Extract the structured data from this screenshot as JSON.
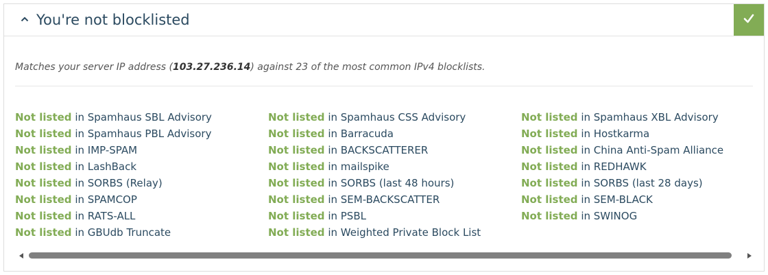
{
  "header": {
    "title": "You're not blocklisted",
    "chevron_icon": "chevron-up-icon",
    "status_icon": "checkmark-icon",
    "status_color": "#82ac55"
  },
  "description": {
    "prefix": "Matches your server IP address (",
    "ip": "103.27.236.14",
    "suffix": ") against 23 of the most common IPv4 blocklists."
  },
  "columns": [
    [
      {
        "status": "Not listed",
        "sep": " in ",
        "name": "Spamhaus SBL Advisory"
      },
      {
        "status": "Not listed",
        "sep": " in ",
        "name": "Spamhaus PBL Advisory"
      },
      {
        "status": "Not listed",
        "sep": " in ",
        "name": "IMP-SPAM"
      },
      {
        "status": "Not listed",
        "sep": " in ",
        "name": "LashBack"
      },
      {
        "status": "Not listed",
        "sep": " in ",
        "name": "SORBS (Relay)"
      },
      {
        "status": "Not listed",
        "sep": " in ",
        "name": "SPAMCOP"
      },
      {
        "status": "Not listed",
        "sep": " in ",
        "name": "RATS-ALL"
      },
      {
        "status": "Not listed",
        "sep": " in ",
        "name": "GBUdb Truncate"
      }
    ],
    [
      {
        "status": "Not listed",
        "sep": " in ",
        "name": "Spamhaus CSS Advisory"
      },
      {
        "status": "Not listed",
        "sep": " in ",
        "name": "Barracuda"
      },
      {
        "status": "Not listed",
        "sep": " in ",
        "name": "BACKSCATTERER"
      },
      {
        "status": "Not listed",
        "sep": " in ",
        "name": "mailspike"
      },
      {
        "status": "Not listed",
        "sep": " in ",
        "name": "SORBS (last 48 hours)"
      },
      {
        "status": "Not listed",
        "sep": " in ",
        "name": "SEM-BACKSCATTER"
      },
      {
        "status": "Not listed",
        "sep": " in ",
        "name": "PSBL"
      },
      {
        "status": "Not listed",
        "sep": " in ",
        "name": "Weighted Private Block List"
      }
    ],
    [
      {
        "status": "Not listed",
        "sep": " in ",
        "name": "Spamhaus XBL Advisory"
      },
      {
        "status": "Not listed",
        "sep": " in ",
        "name": "Hostkarma"
      },
      {
        "status": "Not listed",
        "sep": " in ",
        "name": "China Anti-Spam Alliance"
      },
      {
        "status": "Not listed",
        "sep": " in ",
        "name": "REDHAWK"
      },
      {
        "status": "Not listed",
        "sep": " in ",
        "name": "SORBS (last 28 days)"
      },
      {
        "status": "Not listed",
        "sep": " in ",
        "name": "SEM-BLACK"
      },
      {
        "status": "Not listed",
        "sep": " in ",
        "name": "SWINOG"
      }
    ]
  ],
  "colors": {
    "listed_ok": "#82ac55",
    "text": "#2b4a60"
  },
  "scrollbar": {
    "left_icon": "scroll-left-arrow-icon",
    "right_icon": "scroll-right-arrow-icon"
  }
}
